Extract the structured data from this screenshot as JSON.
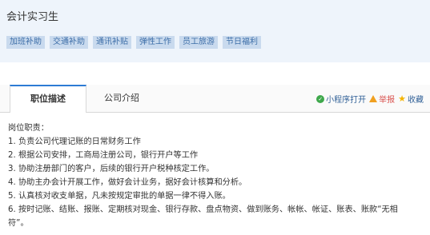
{
  "header": {
    "job_title": "会计实习生",
    "tags": [
      "加班补助",
      "交通补助",
      "通讯补贴",
      "弹性工作",
      "员工旅游",
      "节日福利"
    ]
  },
  "tabs": {
    "description": "职位描述",
    "company": "公司介绍"
  },
  "actions": {
    "miniapp": "小程序打开",
    "report": "举报",
    "favorite": "收藏",
    "icons": [
      "miniapp-icon",
      "warning-icon",
      "star-icon"
    ],
    "colors": {
      "miniapp": "#3ea84b",
      "warning": "#f0a020",
      "star": "#f5b400",
      "report": "#d9534f"
    }
  },
  "responsibilities": {
    "heading": "岗位职责：",
    "items": [
      "1. 负责公司代理记账的日常财务工作",
      "2. 根据公司安排，工商局注册公司，银行开户等工作",
      "3. 协助注册部门的客户，后续的银行开户税种核定工作。",
      "4. 协助主办会计开展工作，做好会计业务，据好会计核算和分析。",
      "5. 认真核对收支单据，凡未按规定审批的单据一律不得入账。",
      "6. 按时记账、结账、报账、定期核对现金、银行存款、盘点物资、做到账务、帐帐、帐证、账表、账款“无相",
      "符”。"
    ]
  }
}
